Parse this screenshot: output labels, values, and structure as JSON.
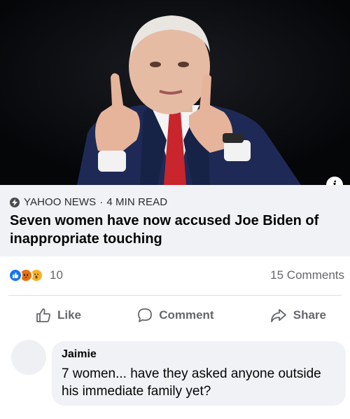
{
  "post": {
    "image_alt": "Man in suit gesturing with raised index fingers",
    "info_glyph": "i",
    "link": {
      "source": "YAHOO NEWS",
      "separator": "·",
      "read_time": "4 MIN READ",
      "headline": "Seven women have now accused Joe Biden of inappropriate touching"
    },
    "reactions": {
      "icons": [
        "like-reaction-icon",
        "angry-reaction-icon",
        "wow-reaction-icon"
      ],
      "count": "10",
      "comments": "15 Comments"
    },
    "actions": [
      {
        "label": "Like",
        "icon": "thumbs-up-icon"
      },
      {
        "label": "Comment",
        "icon": "speech-bubble-icon"
      },
      {
        "label": "Share",
        "icon": "share-arrow-icon"
      }
    ]
  },
  "comment": {
    "author": "Jaimie",
    "text": "7 women... have they asked anyone outside his immediate family yet?"
  },
  "colors": {
    "like_blue": "#1877f2",
    "angry_orange": "#e9710f",
    "wow_yellow": "#f7b125",
    "muted_text": "#65676b",
    "card_bg": "#f0f2f5"
  }
}
